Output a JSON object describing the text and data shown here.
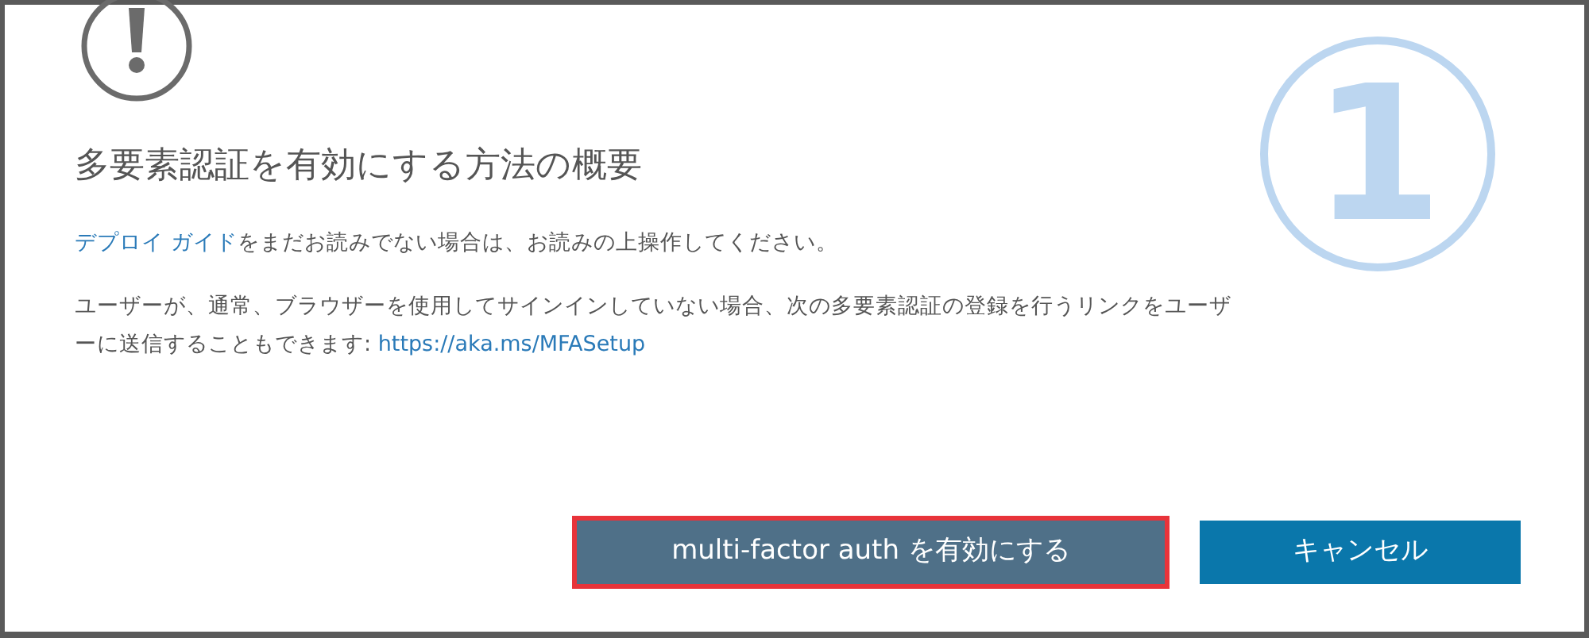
{
  "dialog": {
    "step_badge": "1",
    "title": "多要素認証を有効にする方法の概要",
    "paragraphs": [
      {
        "parts": [
          {
            "kind": "link",
            "text": "デプロイ ガイド"
          },
          {
            "kind": "text",
            "text": "をまだお読みでない場合は、お読みの上操作してください。"
          }
        ]
      },
      {
        "parts": [
          {
            "kind": "text",
            "text": "ユーザーが、通常、ブラウザーを使用してサインインしていない場合、次の多要素認証の登録を行うリンクをユーザーに送信することもできます: "
          },
          {
            "kind": "link",
            "text": "https://aka.ms/MFASetup"
          }
        ]
      }
    ],
    "buttons": [
      {
        "label": "multi-factor auth を有効にする",
        "kind": "primary",
        "highlighted": true
      },
      {
        "label": "キャンセル",
        "kind": "secondary",
        "highlighted": false
      }
    ]
  }
}
